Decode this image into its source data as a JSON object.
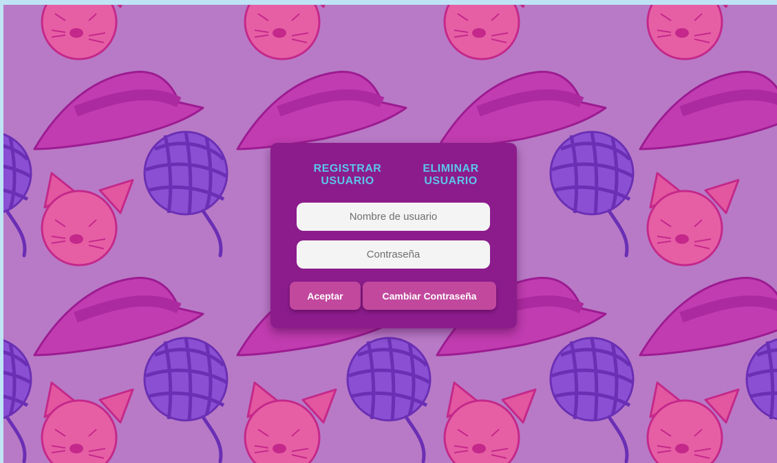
{
  "colors": {
    "page_background": "#b87ac6",
    "panel": "#8c1c8c",
    "tab_text": "#5cc6e8",
    "button": "#c2489e",
    "button_text": "#ffffff",
    "field_background": "#f4f4f4",
    "outer_border": "#bfe3f5"
  },
  "background_pattern": {
    "icons": [
      "cat-face-icon",
      "hat-icon",
      "yarn-ball-icon"
    ]
  },
  "tabs": {
    "registrar": "REGISTRAR USUARIO",
    "eliminar": "ELIMINAR USUARIO"
  },
  "form": {
    "username": {
      "value": "",
      "placeholder": "Nombre de usuario"
    },
    "password": {
      "value": "",
      "placeholder": "Contraseña"
    }
  },
  "buttons": {
    "accept": "Aceptar",
    "change_password": "Cambiar Contraseña"
  }
}
